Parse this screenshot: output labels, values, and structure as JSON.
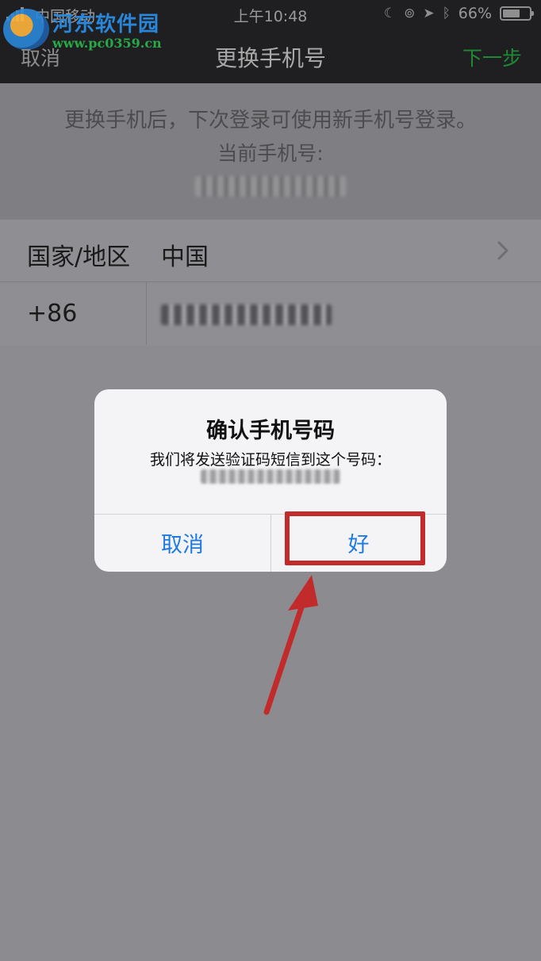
{
  "status_bar": {
    "carrier": "中国移动",
    "time": "上午10:48",
    "battery": "66%",
    "battery_level": 0.66
  },
  "watermark": {
    "title": "河东软件园",
    "url": "www.pc0359.cn"
  },
  "nav": {
    "cancel": "取消",
    "title": "更换手机号",
    "next": "下一步"
  },
  "info": {
    "line1": "更换手机后，下次登录可使用新手机号登录。",
    "line2": "当前手机号:"
  },
  "form": {
    "country_label": "国家/地区",
    "country_value": "中国",
    "code": "+86"
  },
  "dialog": {
    "title": "确认手机号码",
    "message": "我们将发送验证码短信到这个号码：",
    "cancel": "取消",
    "ok": "好"
  },
  "colors": {
    "accent_green": "#1f8a35",
    "link_blue": "#1e7ae0",
    "annotation_red": "#c22b2b"
  }
}
